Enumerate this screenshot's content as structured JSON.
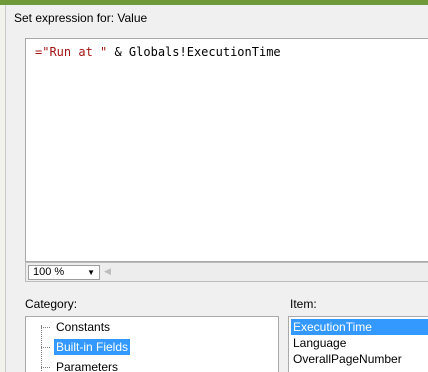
{
  "dialog": {
    "expression_label": "Set expression for: Value",
    "expression": {
      "string_part": "=\"Run at \"",
      "rest_part": " & Globals!ExecutionTime"
    }
  },
  "zoom": {
    "value": "100 %"
  },
  "category": {
    "label": "Category:",
    "items": [
      "Constants",
      "Built-in Fields",
      "Parameters"
    ],
    "selected": "Built-in Fields"
  },
  "item": {
    "label": "Item:",
    "items": [
      "ExecutionTime",
      "Language",
      "OverallPageNumber"
    ],
    "selected": "ExecutionTime"
  },
  "colors": {
    "accent_bar": "#6f9a3b",
    "selection": "#3399ff",
    "string": "#a31515"
  }
}
